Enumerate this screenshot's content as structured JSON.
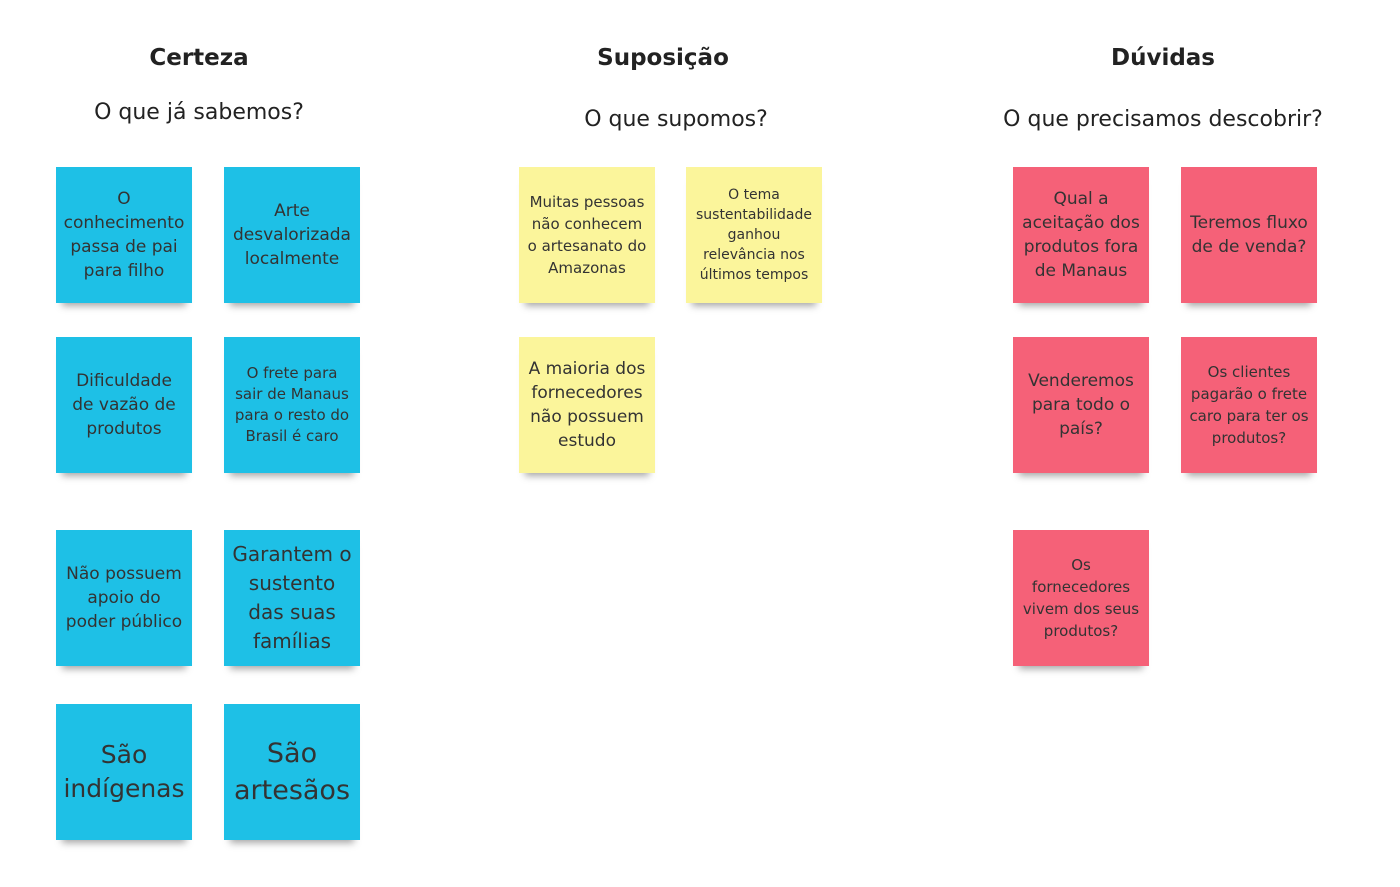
{
  "colors": {
    "certeza": "#1ec0e6",
    "suposicao": "#fbf59b",
    "duvidas": "#f56178"
  },
  "columns": {
    "certeza": {
      "title": "Certeza",
      "subtitle": "O que já sabemos?",
      "notes": [
        "O conhecimento passa de pai para filho",
        "Arte desvalorizada localmente",
        "Dificuldade de vazão de produtos",
        "O frete para sair de Manaus para o resto do Brasil é caro",
        "Não possuem apoio do poder público",
        "Garantem o sustento das suas famílias",
        "São indígenas",
        "São artesãos"
      ]
    },
    "suposicao": {
      "title": "Suposição",
      "subtitle": "O que supomos?",
      "notes": [
        "Muitas pessoas não conhecem o artesanato do Amazonas",
        "O tema sustentabilidade ganhou relevância nos últimos tempos",
        "A maioria dos fornecedores não possuem estudo"
      ]
    },
    "duvidas": {
      "title": "Dúvidas",
      "subtitle": "O que precisamos descobrir?",
      "notes": [
        "Qual a aceitação dos produtos fora de Manaus",
        "Teremos fluxo de de venda?",
        "Venderemos para todo o país?",
        "Os clientes pagarão o frete caro para ter os produtos?",
        "Os fornecedores vivem dos seus produtos?"
      ]
    }
  }
}
